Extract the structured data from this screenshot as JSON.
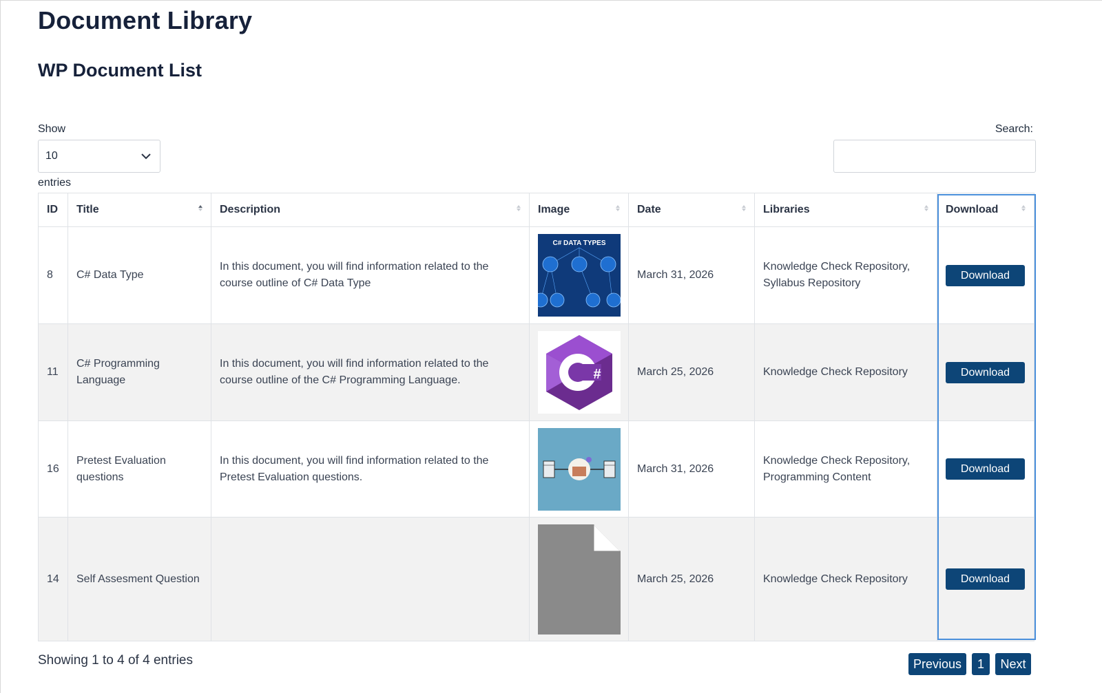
{
  "page": {
    "title": "Document Library",
    "subtitle": "WP Document List"
  },
  "controls": {
    "show_label": "Show",
    "page_size": "10",
    "entries_label": "entries",
    "search_label": "Search:",
    "search_value": ""
  },
  "table": {
    "headers": {
      "id": "ID",
      "title": "Title",
      "description": "Description",
      "image": "Image",
      "date": "Date",
      "libraries": "Libraries",
      "download": "Download"
    },
    "rows": [
      {
        "id": "8",
        "title": "C# Data Type",
        "description": "In this document, you will find information related to the course outline of C# Data Type",
        "image_icon": "csharp-data-types-diagram",
        "image_text": "C# DATA TYPES",
        "date": "March 31, 2026",
        "libraries": "Knowledge Check Repository, Syllabus Repository",
        "download_label": "Download"
      },
      {
        "id": "11",
        "title": "C# Programming Language",
        "description": "In this document, you will find information related to the course outline of the C# Programming Language.",
        "image_icon": "csharp-logo",
        "image_text": "#",
        "date": "March 25, 2026",
        "libraries": "Knowledge Check Repository",
        "download_label": "Download"
      },
      {
        "id": "16",
        "title": "Pretest Evaluation questions",
        "description": "In this document, you will find information related to the Pretest Evaluation questions.",
        "image_icon": "pretest-illustration",
        "image_text": "",
        "date": "March 31, 2026",
        "libraries": "Knowledge Check Repository, Programming Content",
        "download_label": "Download"
      },
      {
        "id": "14",
        "title": "Self Assesment Question",
        "description": "",
        "image_icon": "generic-file-icon",
        "image_text": "",
        "date": "March 25, 2026",
        "libraries": "Knowledge Check Repository",
        "download_label": "Download"
      }
    ]
  },
  "footer": {
    "info": "Showing 1 to 4 of 4 entries",
    "previous_label": "Previous",
    "current_page": "1",
    "next_label": "Next"
  },
  "colors": {
    "button": "#0d4577",
    "highlight_border": "#4a8fdb",
    "stripe": "#f2f2f2"
  }
}
